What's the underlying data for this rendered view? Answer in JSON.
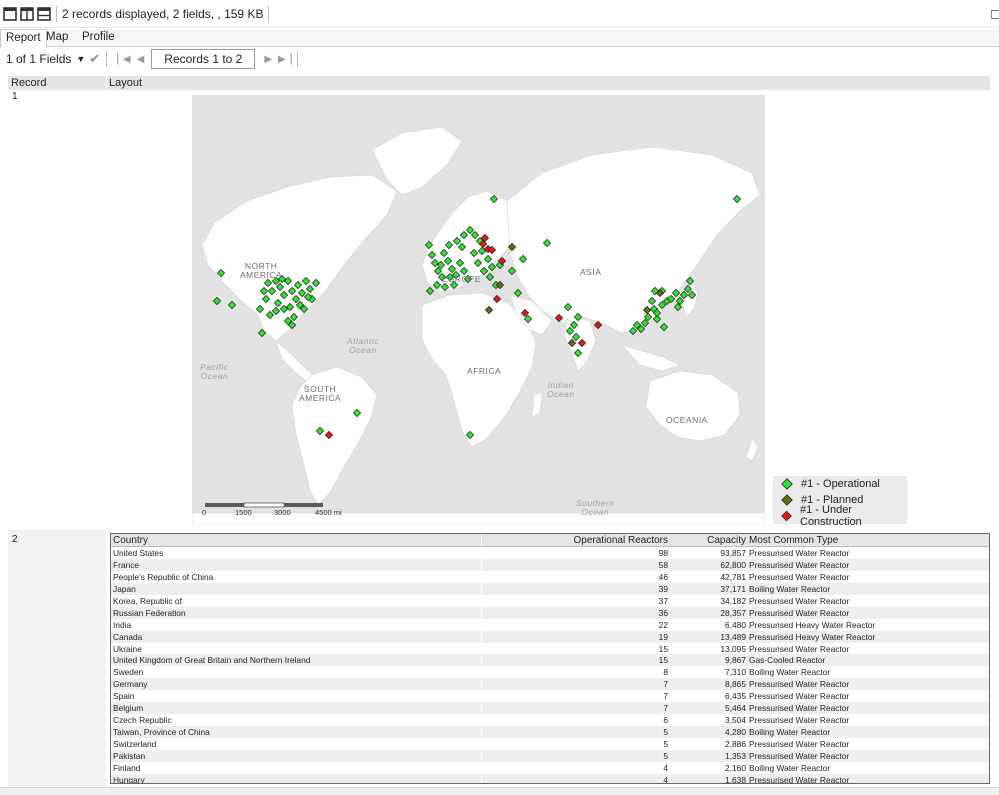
{
  "toolbar": {
    "summary": "2 records displayed, 2 fields, , 159 KB"
  },
  "tabs": [
    {
      "label": "Report",
      "active": true
    },
    {
      "label": "Map",
      "active": false
    },
    {
      "label": "Profile",
      "active": false
    }
  ],
  "nav": {
    "fields_label": "1 of 1 Fields",
    "records_label": "Records 1 to 2"
  },
  "grid": {
    "col_record": "Record",
    "col_layout": "Layout",
    "row1": "1",
    "row2": "2"
  },
  "map": {
    "labels": {
      "north_america": "NORTH\nAMERICA",
      "south_america": "SOUTH\nAMERICA",
      "europe": "EUROPE",
      "asia": "ASIA",
      "africa": "AFRICA",
      "oceania": "OCEANIA"
    },
    "oceans": {
      "atlantic": "Atlantic\nOcean",
      "pacific": "Pacific\nOcean",
      "indian": "Indian\nOcean",
      "southern": "Southern\nOcean"
    },
    "scale_ticks": [
      "0",
      "1500",
      "3000",
      "4500 mi"
    ],
    "colors": {
      "operational": "#2ee62e",
      "planned": "#6b6b10",
      "under_construction": "#e81818"
    }
  },
  "legend": [
    {
      "label": "#1 - Operational",
      "status": "operational"
    },
    {
      "label": "#1 - Planned",
      "status": "planned"
    },
    {
      "label": "#1 - Under Construction",
      "status": "under_construction"
    }
  ],
  "table": {
    "headers": [
      "Country",
      "Operational Reactors",
      "Capacity",
      "Most Common Type"
    ],
    "rows": [
      [
        "United States",
        "98",
        "93,857",
        "Pressurised Water Reactor"
      ],
      [
        "France",
        "58",
        "62,800",
        "Pressurised Water Reactor"
      ],
      [
        "People's Republic of China",
        "46",
        "42,781",
        "Pressurised Water Reactor"
      ],
      [
        "Japan",
        "39",
        "37,171",
        "Boiling Water Reactor"
      ],
      [
        "Korea, Republic of",
        "37",
        "34,182",
        "Pressurised Water Reactor"
      ],
      [
        "Russian Federation",
        "36",
        "28,357",
        "Pressurised Water Reactor"
      ],
      [
        "India",
        "22",
        "6,480",
        "Pressurised Heavy Water Reactor"
      ],
      [
        "Canada",
        "19",
        "13,489",
        "Pressurised Heavy Water Reactor"
      ],
      [
        "Ukraine",
        "15",
        "13,095",
        "Pressurised Water Reactor"
      ],
      [
        "United Kingdom of Great Britain and Northern Ireland",
        "15",
        "9,867",
        "Gas-Cooled Reactor"
      ],
      [
        "Sweden",
        "8",
        "7,310",
        "Boiling Water Reactor"
      ],
      [
        "Germany",
        "7",
        "8,865",
        "Pressurised Water Reactor"
      ],
      [
        "Spain",
        "7",
        "6,435",
        "Pressurised Water Reactor"
      ],
      [
        "Belgium",
        "7",
        "5,464",
        "Pressurised Water Reactor"
      ],
      [
        "Czech Republic",
        "6",
        "3,504",
        "Pressurised Water Reactor"
      ],
      [
        "Taiwan, Province of China",
        "5",
        "4,280",
        "Boiling Water Reactor"
      ],
      [
        "Switzerland",
        "5",
        "2,886",
        "Pressurised Water Reactor"
      ],
      [
        "Pakistan",
        "5",
        "1,353",
        "Pressurised Water Reactor"
      ],
      [
        "Finland",
        "4",
        "2,160",
        "Boiling Water Reactor"
      ],
      [
        "Hungary",
        "4",
        "1,638",
        "Pressurised Water Reactor"
      ]
    ]
  }
}
